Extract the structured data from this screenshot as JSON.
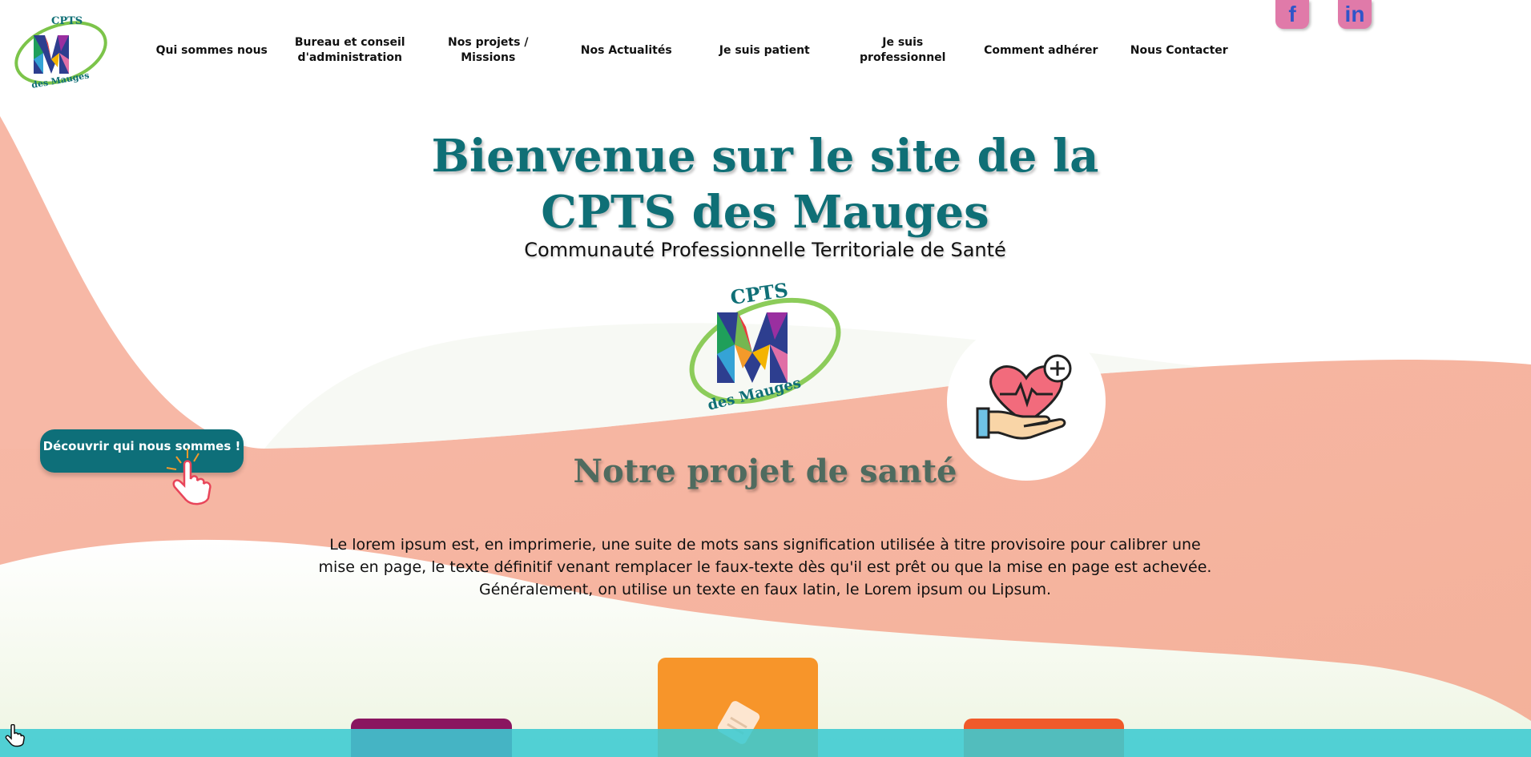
{
  "nav": {
    "items": [
      "Qui sommes nous",
      "Bureau et conseil d'administration",
      "Nos projets / Missions",
      "Nos Actualités",
      "Je suis patient",
      "Je suis professionnel",
      "Comment adhérer",
      "Nous Contacter"
    ]
  },
  "social": {
    "facebook": "f",
    "linkedin": "in"
  },
  "logo": {
    "top_text": "CPTS",
    "bottom_text": "des Mauges"
  },
  "hero": {
    "title_line1": "Bienvenue sur le site de la",
    "title_line2": "CPTS des Mauges",
    "subtitle": "Communauté Professionnelle Territoriale de Santé"
  },
  "cta": {
    "label": "Découvrir qui nous sommes !"
  },
  "section": {
    "title": "Notre projet de santé",
    "text": "Le lorem ipsum est, en imprimerie, une suite de mots sans signification utilisée à titre provisoire pour calibrer une mise en page, le texte définitif venant remplacer le faux-texte dès qu'il est prêt ou que la mise en page est achevée. Généralement, on utilise un texte en faux latin, le Lorem ipsum ou Lipsum."
  },
  "colors": {
    "teal": "#0e6f79",
    "salmon": "#f6b9a8",
    "mint": "#eef5e6",
    "accent_pink": "#e07aa9",
    "bar": "#3bcbd2"
  },
  "icons": [
    "facebook-icon",
    "linkedin-icon",
    "heart-hand-icon",
    "pointer-hand-icon",
    "document-icon",
    "cursor-icon"
  ]
}
